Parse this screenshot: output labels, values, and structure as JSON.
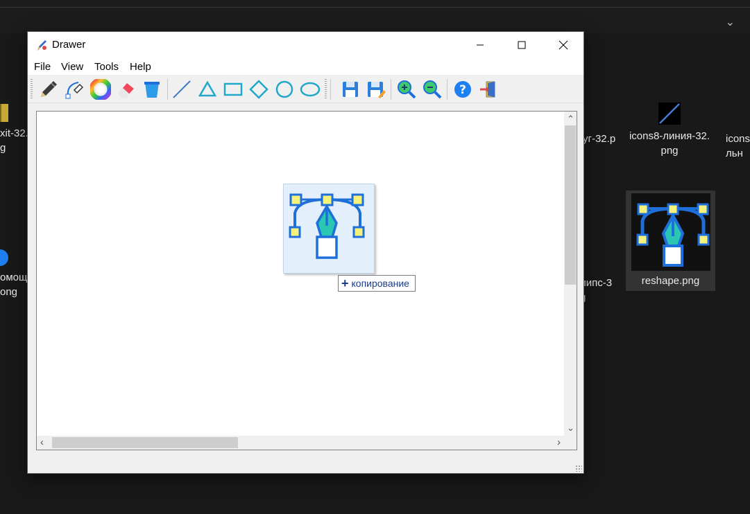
{
  "desktop": {
    "icons": [
      {
        "label": "xit-32.\ng"
      },
      {
        "label": "омощ\nong"
      },
      {
        "label": "уг-32.p"
      },
      {
        "label": "липс-3\ng"
      },
      {
        "label": "icons8-линия-32.\npng"
      },
      {
        "label": "icons\nльн"
      },
      {
        "label": "reshape.png"
      }
    ]
  },
  "window": {
    "title": "Drawer",
    "menu": [
      "File",
      "View",
      "Tools",
      "Help"
    ],
    "toolbar_tools": [
      "pencil-icon",
      "bezier-pen-icon",
      "color-wheel-icon",
      "eraser-icon",
      "bucket-icon",
      "line-icon",
      "triangle-icon",
      "rectangle-icon",
      "diamond-icon",
      "circle-icon",
      "ellipse-icon",
      "save-icon",
      "save-as-icon",
      "zoom-in-icon",
      "zoom-out-icon",
      "help-icon",
      "exit-icon"
    ],
    "drag_tooltip": "копирование"
  },
  "colors": {
    "accent": "#1e6fd9",
    "teal": "#2bc5b4",
    "node_fill": "#f4f27a",
    "bg": "#191919"
  }
}
